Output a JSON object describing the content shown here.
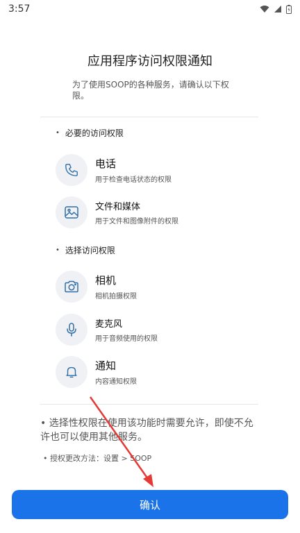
{
  "status_bar": {
    "time": "3:57"
  },
  "title": "应用程序访问权限通知",
  "description": "为了使用SOOP的各种服务，请确认以下权限。",
  "required_section": {
    "heading": "必要的访问权限",
    "items": [
      {
        "icon": "phone-icon",
        "name": "电话",
        "desc": "用于检查电话状态的权限"
      },
      {
        "icon": "image-icon",
        "name": "文件和媒体",
        "desc": "用于文件和图像附件的权限"
      }
    ]
  },
  "optional_section": {
    "heading": "选择访问权限",
    "items": [
      {
        "icon": "camera-icon",
        "name": "相机",
        "desc": "相机拍摄权限"
      },
      {
        "icon": "microphone-icon",
        "name": "麦克风",
        "desc": "用于音频使用的权限"
      },
      {
        "icon": "bell-icon",
        "name": "通知",
        "desc": "内容通知权限"
      }
    ]
  },
  "note": "选择性权限在使用该功能时需要允许，即使不允许也可以使用其他服务。",
  "change_note": "授权更改方法：设置 > SOOP",
  "confirm_label": "确认",
  "colors": {
    "accent": "#1a73e8",
    "arrow": "#e53935",
    "icon_bg": "#eff1f4",
    "icon_stroke": "#2f6fa8"
  }
}
